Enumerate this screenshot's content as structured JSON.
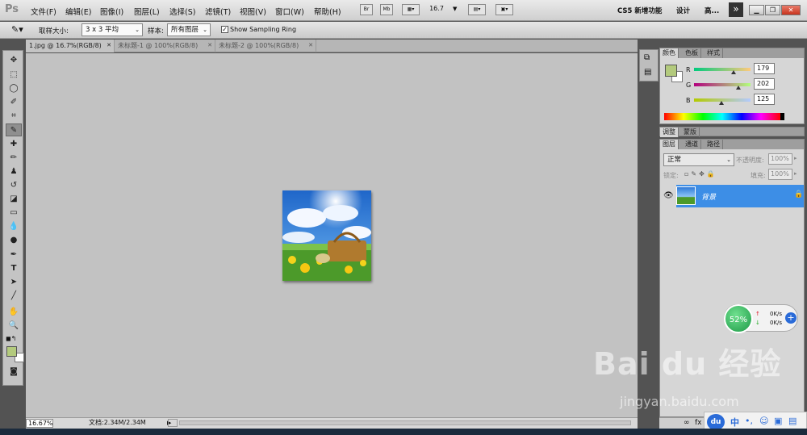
{
  "app": {
    "logo": "Ps"
  },
  "menu": [
    "文件(F)",
    "编辑(E)",
    "图像(I)",
    "图层(L)",
    "选择(S)",
    "滤镜(T)",
    "视图(V)",
    "窗口(W)",
    "帮助(H)"
  ],
  "appbar": {
    "bridge_label": "Br",
    "minibridge_label": "Mb",
    "zoom_value": "16.7"
  },
  "workspace": {
    "new_features": "CS5 新增功能",
    "design": "设计",
    "more": "高..."
  },
  "options": {
    "sample_size_label": "取样大小:",
    "sample_size_value": "3 x 3 平均",
    "sample_label": "样本:",
    "sample_value": "所有图层",
    "sampling_ring_label": "Show Sampling Ring"
  },
  "tabs": [
    {
      "label": "1.jpg @ 16.7%(RGB/8)",
      "active": true
    },
    {
      "label": "未标题-1 @ 100%(RGB/8)",
      "active": false
    },
    {
      "label": "未标题-2 @ 100%(RGB/8)",
      "active": false
    }
  ],
  "status": {
    "zoom": "16.67%",
    "doc_info": "文档:2.34M/2.34M"
  },
  "color_panel": {
    "tabs": [
      "颜色",
      "色板",
      "样式"
    ],
    "r": {
      "label": "R",
      "value": "179"
    },
    "g": {
      "label": "G",
      "value": "202"
    },
    "b": {
      "label": "B",
      "value": "125"
    },
    "foreground": "#b3ca7d",
    "background": "#ffffff"
  },
  "adjust_panel": {
    "tabs": [
      "调整",
      "蒙版"
    ]
  },
  "layers_panel": {
    "tabs": [
      "图层",
      "通道",
      "路径"
    ],
    "blend_mode": "正常",
    "opacity_label": "不透明度:",
    "opacity_value": "100%",
    "lock_label": "锁定:",
    "fill_label": "填充:",
    "fill_value": "100%",
    "layer_name": "背景"
  },
  "widget": {
    "percent": "52%",
    "up": "0K/s",
    "down": "0K/s"
  },
  "watermark": {
    "text": "Bai du 经验",
    "url": "jingyan.baidu.com"
  },
  "tray": {
    "du": "du",
    "ime": "中"
  }
}
